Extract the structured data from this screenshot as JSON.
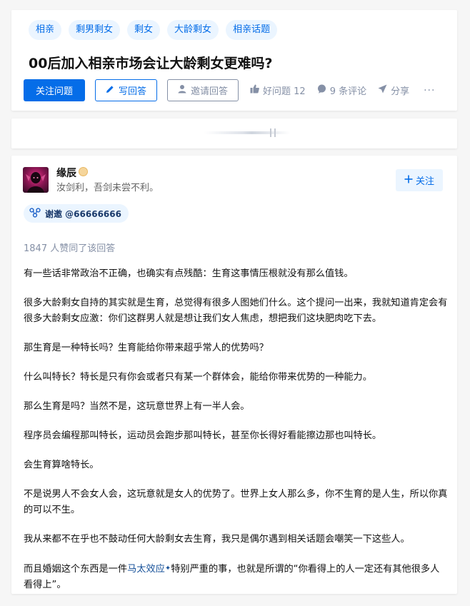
{
  "question": {
    "topics": [
      "相亲",
      "剩男剩女",
      "剩女",
      "大龄剩女",
      "相亲话题"
    ],
    "title": "00后加入相亲市场会让大龄剩女更难吗?",
    "actions": {
      "follow_label": "关注问题",
      "write_label": "写回答",
      "invite_label": "邀请回答",
      "good_question_label": "好问题 12",
      "comments_label": "9 条评论",
      "share_label": "分享",
      "more_label": "···"
    }
  },
  "answer": {
    "author": {
      "name": "缘辰",
      "bio": "汝剑利，吾剑未尝不利。",
      "follow_label": "关注"
    },
    "thanks": "谢邀 @66666666",
    "votes": "1847 人赞同了该回答",
    "paragraphs": [
      "有一些话非常政治不正确，也确实有点残酷：生育这事情压根就没有那么值钱。",
      "很多大龄剩女自持的其实就是生育，总觉得有很多人图她们什么。这个提问一出来，我就知道肯定会有很多大龄剩女应激：你们这群男人就是想让我们女人焦虑，想把我们这块肥肉吃下去。",
      "那生育是一种特长吗？生育能给你带来超乎常人的优势吗？",
      "什么叫特长？特长是只有你会或者只有某一个群体会，能给你带来优势的一种能力。",
      "那么生育是吗？当然不是，这玩意世界上有一半人会。",
      "程序员会编程那叫特长，运动员会跑步那叫特长，甚至你长得好看能擦边那也叫特长。",
      "会生育算啥特长。",
      "不是说男人不会女人会，这玩意就是女人的优势了。世界上女人那么多，你不生育的是人生，所以你真的可以不生。",
      "我从来都不在乎也不鼓动任何大龄剩女去生育，我只是偶尔遇到相关话题会嘲笑一下这些人。"
    ],
    "last_paragraph": {
      "before": "而且婚姻这个东西是一件",
      "link": "马太效应",
      "after": "特别严重的事，也就是所谓的“你看得上的人一定还有其他很多人看得上”。"
    }
  },
  "colors": {
    "brand": "#056de8",
    "chip_bg": "#ebf5ff",
    "muted": "#8590a6",
    "link": "#175199"
  }
}
